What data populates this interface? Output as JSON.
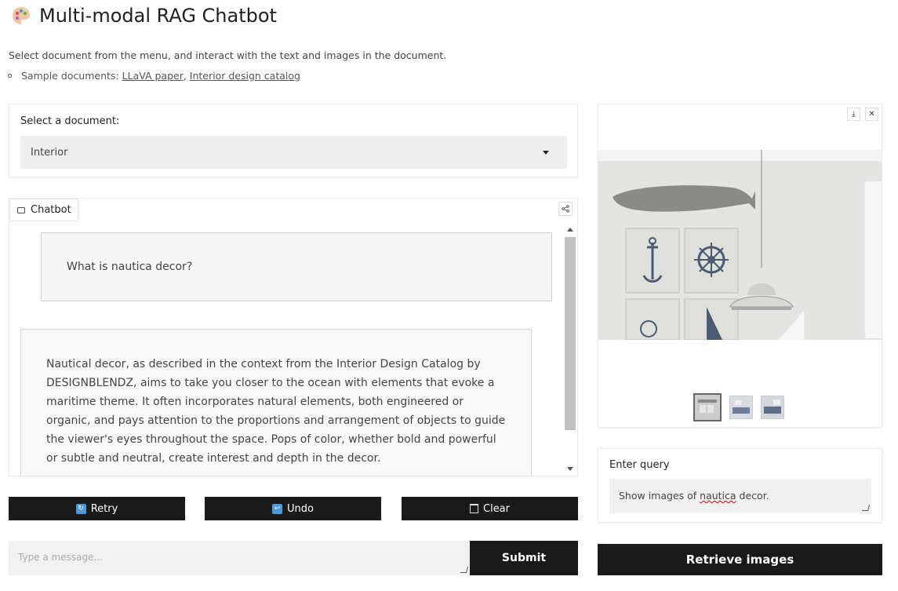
{
  "app": {
    "title": "Multi-modal RAG Chatbot",
    "description": "Select document from the menu, and interact with the text and images in the document.",
    "samples_prefix": "Sample documents: ",
    "samples": [
      {
        "label": "LLaVA paper"
      },
      {
        "label": "Interior design catalog"
      }
    ],
    "samples_separator": ", "
  },
  "document": {
    "label": "Select a document:",
    "selected": "Interior"
  },
  "chatbot": {
    "tab_label": "Chatbot",
    "messages": [
      {
        "role": "user",
        "text": "What is nautica decor?"
      },
      {
        "role": "assistant",
        "text": "Nautical decor, as described in the context from the Interior Design Catalog by DESIGNBLENDZ, aims to take you closer to the ocean with elements that evoke a maritime theme. It often incorporates natural elements, both engineered or organic, and pays attention to the proportions and arrangement of objects to guide the viewer's eyes throughout the space. Pops of color, whether bold and powerful or subtle and neutral, create interest and depth in the decor."
      }
    ]
  },
  "actions": {
    "retry": "Retry",
    "undo": "Undo",
    "clear": "Clear",
    "submit": "Submit"
  },
  "message_input": {
    "placeholder": "Type a message..."
  },
  "gallery": {
    "thumbnails_count": 3,
    "selected_index": 0
  },
  "query": {
    "label": "Enter query",
    "value_before": "Show images of ",
    "value_misspelled": "nautica",
    "value_after": " decor."
  },
  "retrieve": {
    "label": "Retrieve images"
  },
  "colors": {
    "button_bg": "#1a1a1a",
    "button_icon": "#4a9ad8",
    "input_bg": "#f0f0f0"
  }
}
